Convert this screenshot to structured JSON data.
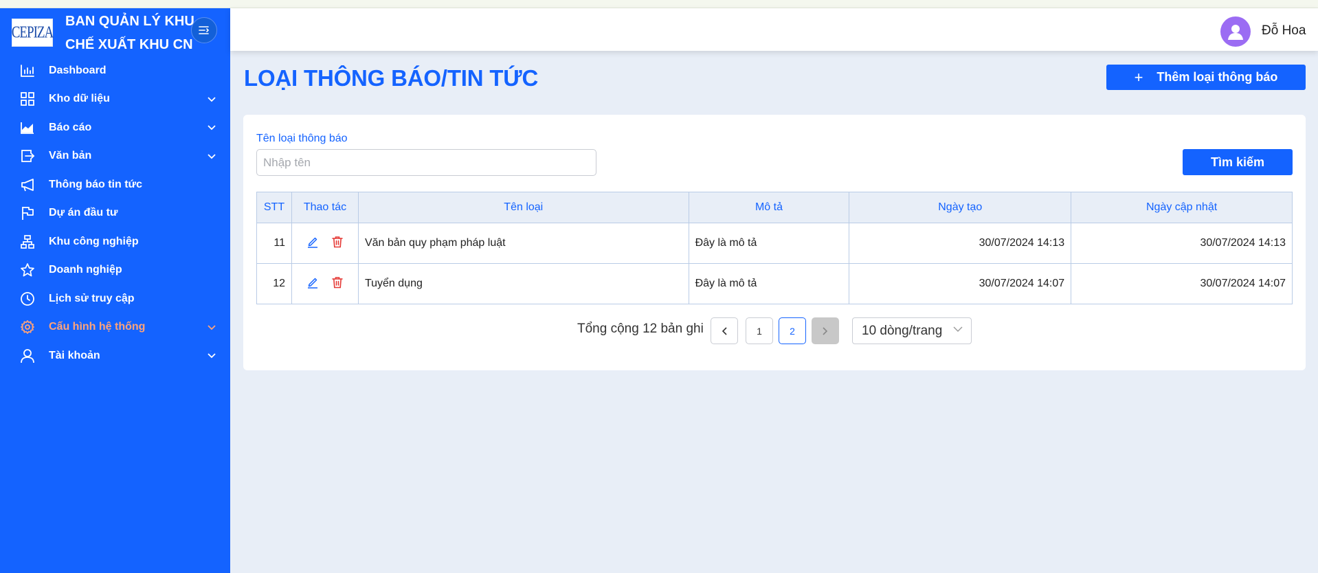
{
  "brand": {
    "logo_text": "CEPIZA",
    "line1": "BAN QUẢN LÝ KHU",
    "line2": "CHẾ XUẤT KHU CN"
  },
  "sidebar": {
    "items": [
      {
        "label": "Dashboard",
        "icon": "bar-chart-icon",
        "has_children": false
      },
      {
        "label": "Kho dữ liệu",
        "icon": "grid-icon",
        "has_children": true
      },
      {
        "label": "Báo cáo",
        "icon": "area-chart-icon",
        "has_children": true
      },
      {
        "label": "Văn bản",
        "icon": "document-export-icon",
        "has_children": true
      },
      {
        "label": "Thông báo tin tức",
        "icon": "megaphone-icon",
        "has_children": false
      },
      {
        "label": "Dự án đầu tư",
        "icon": "flag-icon",
        "has_children": false
      },
      {
        "label": "Khu công nghiệp",
        "icon": "hierarchy-icon",
        "has_children": false
      },
      {
        "label": "Doanh nghiệp",
        "icon": "star-icon",
        "has_children": false
      },
      {
        "label": "Lịch sử truy cập",
        "icon": "clock-icon",
        "has_children": false
      },
      {
        "label": "Cấu hình hệ thống",
        "icon": "gear-icon",
        "has_children": true,
        "active": true
      },
      {
        "label": "Tài khoản",
        "icon": "user-icon",
        "has_children": true
      }
    ],
    "active_color": "#ffa37a"
  },
  "header": {
    "username": "Đỗ Hoa",
    "avatar_color": "#9b6cf3"
  },
  "page": {
    "title": "LOẠI THÔNG BÁO/TIN TỨC",
    "add_button": "Thêm loại thông báo"
  },
  "filter": {
    "label": "Tên loại thông báo",
    "placeholder": "Nhập tên",
    "value": "",
    "search_button": "Tìm kiếm"
  },
  "table": {
    "columns": [
      "STT",
      "Thao tác",
      "Tên loại",
      "Mô tả",
      "Ngày tạo",
      "Ngày cập nhật"
    ],
    "rows": [
      {
        "stt": "11",
        "name": "Văn bản quy phạm pháp luật",
        "desc": "Đây là mô tả",
        "created": "30/07/2024 14:13",
        "updated": "30/07/2024 14:13"
      },
      {
        "stt": "12",
        "name": "Tuyển dụng",
        "desc": "Đây là mô tả",
        "created": "30/07/2024 14:07",
        "updated": "30/07/2024 14:07"
      }
    ]
  },
  "pagination": {
    "total_text": "Tổng cộng 12 bản ghi",
    "pages": [
      "1",
      "2"
    ],
    "current_page": "2",
    "page_size": "10 dòng/trang"
  },
  "colors": {
    "primary": "#1463ff",
    "danger": "#e53935",
    "background": "#e8eef7"
  }
}
